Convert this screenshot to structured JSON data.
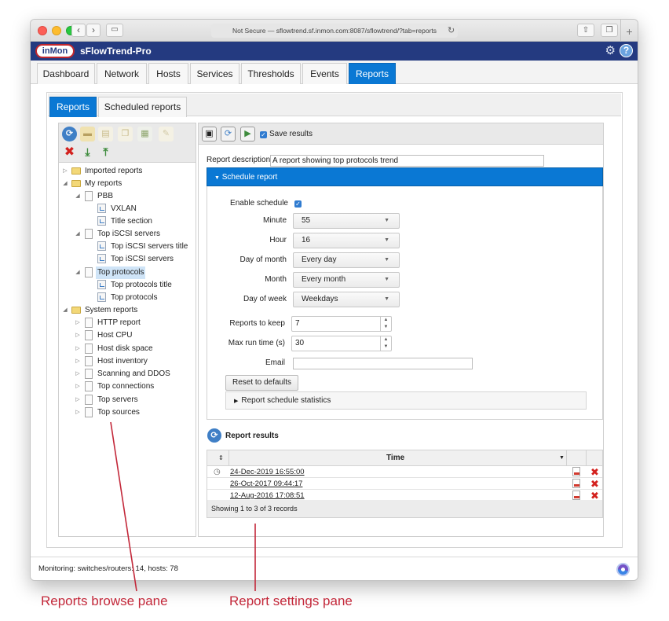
{
  "browser": {
    "url": "Not Secure — sflowtrend.sf.inmon.com:8087/sflowtrend/?tab=reports"
  },
  "app": {
    "logo_text": "inMon",
    "name": "sFlowTrend-Pro"
  },
  "main_tabs": [
    {
      "label": "Dashboard"
    },
    {
      "label": "Network"
    },
    {
      "label": "Hosts"
    },
    {
      "label": "Services"
    },
    {
      "label": "Thresholds"
    },
    {
      "label": "Events"
    },
    {
      "label": "Reports"
    }
  ],
  "sub_tabs": [
    {
      "label": "Reports"
    },
    {
      "label": "Scheduled reports"
    }
  ],
  "tree": {
    "imported": "Imported reports",
    "my_reports": "My reports",
    "pbb": "PBB",
    "vxlan": "VXLAN",
    "title_section": "Title section",
    "top_iscsi": "Top iSCSI servers",
    "top_iscsi_title": "Top iSCSI servers title",
    "top_iscsi_item": "Top iSCSI servers",
    "top_protocols": "Top protocols",
    "top_protocols_title": "Top protocols title",
    "top_protocols_item": "Top protocols",
    "system_reports": "System reports",
    "system_items": [
      "HTTP report",
      "Host CPU",
      "Host disk space",
      "Host inventory",
      "Scanning and DDOS",
      "Top connections",
      "Top servers",
      "Top sources"
    ]
  },
  "settings": {
    "save_results_label": "Save results",
    "report_description_label": "Report description",
    "report_description_value": "A report showing top protocols trend",
    "schedule_header": "Schedule report",
    "enable_schedule_label": "Enable schedule",
    "minute_label": "Minute",
    "minute_value": "55",
    "hour_label": "Hour",
    "hour_value": "16",
    "day_of_month_label": "Day of month",
    "day_of_month_value": "Every day",
    "month_label": "Month",
    "month_value": "Every month",
    "day_of_week_label": "Day of week",
    "day_of_week_value": "Weekdays",
    "reports_to_keep_label": "Reports to keep",
    "reports_to_keep_value": "7",
    "max_run_time_label": "Max run time (s)",
    "max_run_time_value": "30",
    "email_label": "Email",
    "email_value": "",
    "reset_button": "Reset to defaults",
    "stats_label": "Report schedule statistics"
  },
  "results": {
    "title": "Report results",
    "time_header": "Time",
    "rows": [
      {
        "time": "24-Dec-2019 16:55:00"
      },
      {
        "time": "26-Oct-2017 09:44:17"
      },
      {
        "time": "12-Aug-2016 17:08:51"
      }
    ],
    "footer": "Showing 1 to 3 of 3 records"
  },
  "status": {
    "text": "Monitoring: switches/routers: 14, hosts: 78"
  },
  "annotations": {
    "left": "Reports browse pane",
    "right": "Report settings pane"
  },
  "colors": {
    "accent": "#0a78d4",
    "header": "#243a80",
    "annotation": "#c3283a"
  }
}
